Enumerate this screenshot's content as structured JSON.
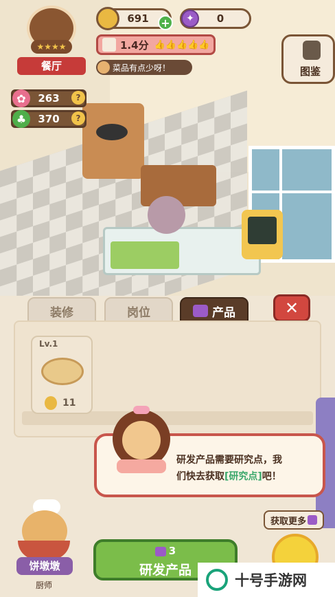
{
  "hud": {
    "gold_amount": "691",
    "gem_amount": "0",
    "rating_label": "1.4分",
    "restaurant_label": "餐厅",
    "hint_text": "菜品有点少呀！",
    "flower_amount": "263",
    "clover_amount": "370",
    "catalog_label": "图鉴",
    "plus_symbol": "+",
    "question_symbol": "?"
  },
  "tabs": [
    {
      "label": "装修"
    },
    {
      "label": "岗位"
    },
    {
      "label": "产品"
    }
  ],
  "product_card": {
    "level": "Lv.1",
    "price": "11"
  },
  "dialog": {
    "line1": "研发产品需要研究点，我",
    "line2_a": "们快去获取",
    "line2_link": "[研究点]",
    "line2_b": "吧！"
  },
  "footer": {
    "chef_name": "饼墩墩",
    "chef_role": "厨师",
    "research_cost": "3",
    "research_button": "研发产品",
    "get_more": "获取更多"
  },
  "watermark": {
    "text": "十号手游网"
  },
  "close_symbol": "✕"
}
